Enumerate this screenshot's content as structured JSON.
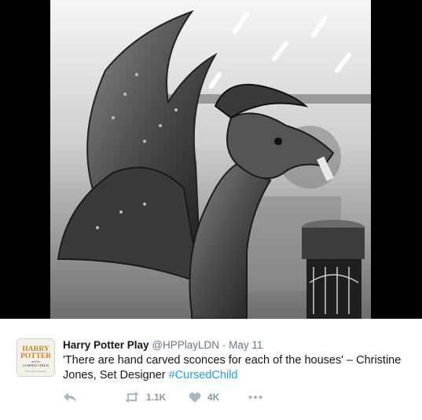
{
  "tweet": {
    "display_name": "Harry Potter Play",
    "handle": "@HPPlayLDN",
    "separator": "·",
    "date": "May 11",
    "text": "'There are hand carved sconces for each of the houses' – Christine Jones, Set Designer ",
    "hashtag": "#CursedChild",
    "retweets": "1.1K",
    "likes": "4K"
  },
  "avatar": {
    "line1": "HARRY",
    "line2": "POTTER",
    "line3": "and the",
    "line4": "CURSED CHILD",
    "line5": "PALACE THEATRE"
  },
  "icons": {
    "reply": "reply-icon",
    "retweet": "retweet-icon",
    "like": "heart-icon",
    "more": "more-icon"
  },
  "colors": {
    "link": "#1da1f2",
    "icon": "#aab8c2",
    "text": "#14171a",
    "muted": "#657786"
  }
}
